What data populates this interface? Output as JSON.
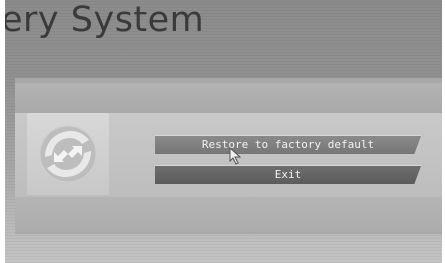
{
  "window": {
    "title": "ery System"
  },
  "dialog": {
    "logo_icon": "recovery-arrows-icon",
    "buttons": {
      "restore_label": "Restore to factory default",
      "exit_label": "Exit"
    }
  },
  "cursor_icon": "mouse-pointer-icon",
  "colors": {
    "background": "#9a9a9a",
    "panel": "#c4c4c4",
    "button": "#767676"
  }
}
